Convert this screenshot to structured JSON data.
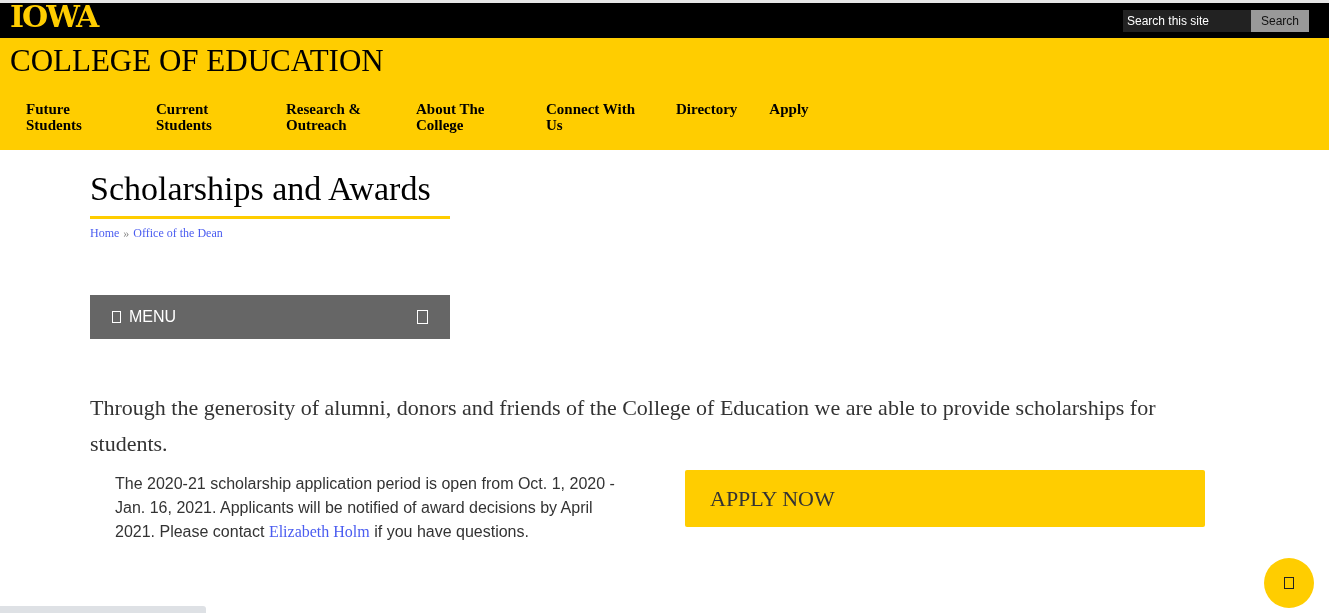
{
  "header": {
    "logo": "IOWA",
    "search": {
      "placeholder": "Search this site",
      "button": "Search"
    }
  },
  "site_title": "COLLEGE OF EDUCATION",
  "nav": [
    {
      "label": "Future Students"
    },
    {
      "label": "Current Students"
    },
    {
      "label": "Research & Outreach"
    },
    {
      "label": "About The College"
    },
    {
      "label": "Connect With Us"
    },
    {
      "label": "Directory"
    },
    {
      "label": "Apply"
    }
  ],
  "page_title": "Scholarships and Awards",
  "breadcrumb": [
    {
      "label": "Home"
    },
    {
      "label": "Office of the Dean"
    }
  ],
  "breadcrumb_separator": "»",
  "menu_button": "MENU",
  "intro": "Through the generosity of alumni, donors and friends of the College of Education we are able to provide scholarships for students.",
  "notice": {
    "before": "The 2020-21 scholarship application period is open from Oct. 1, 2020 - Jan. 16, 2021. Applicants will be notified of award decisions by April 2021. Please contact",
    "link": "Elizabeth Holm",
    "after": "if you have questions."
  },
  "apply_button": "APPLY NOW"
}
